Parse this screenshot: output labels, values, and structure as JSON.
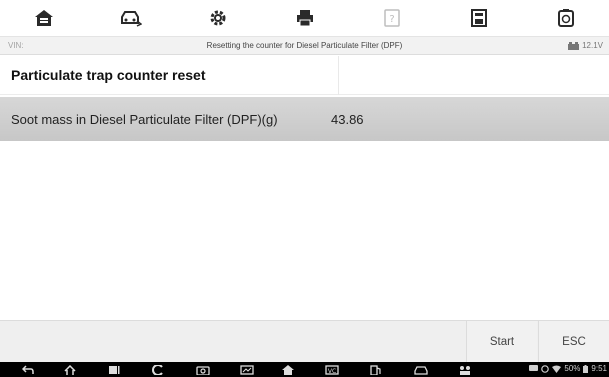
{
  "toolbar": {
    "icons": [
      "home-icon",
      "vehicle-swap-icon",
      "settings-gear-icon",
      "print-icon",
      "help-icon",
      "save-icon",
      "data-log-icon"
    ]
  },
  "statusline": {
    "vin_label": "VIN:",
    "title": "Resetting the counter for Diesel Particulate Filter (DPF)",
    "voltage": "12.1V"
  },
  "heading": {
    "label": "Particulate trap counter reset"
  },
  "data_rows": [
    {
      "name": "Soot mass in Diesel Particulate Filter (DPF)(g)",
      "value": "43.86"
    }
  ],
  "buttons": {
    "start": "Start",
    "esc": "ESC"
  },
  "system": {
    "battery": "50%",
    "time": "9:51"
  },
  "colors": {
    "toolbar_icon": "#2a2a2a",
    "selected_row": "#cfcfcf",
    "navbar": "#000000"
  }
}
